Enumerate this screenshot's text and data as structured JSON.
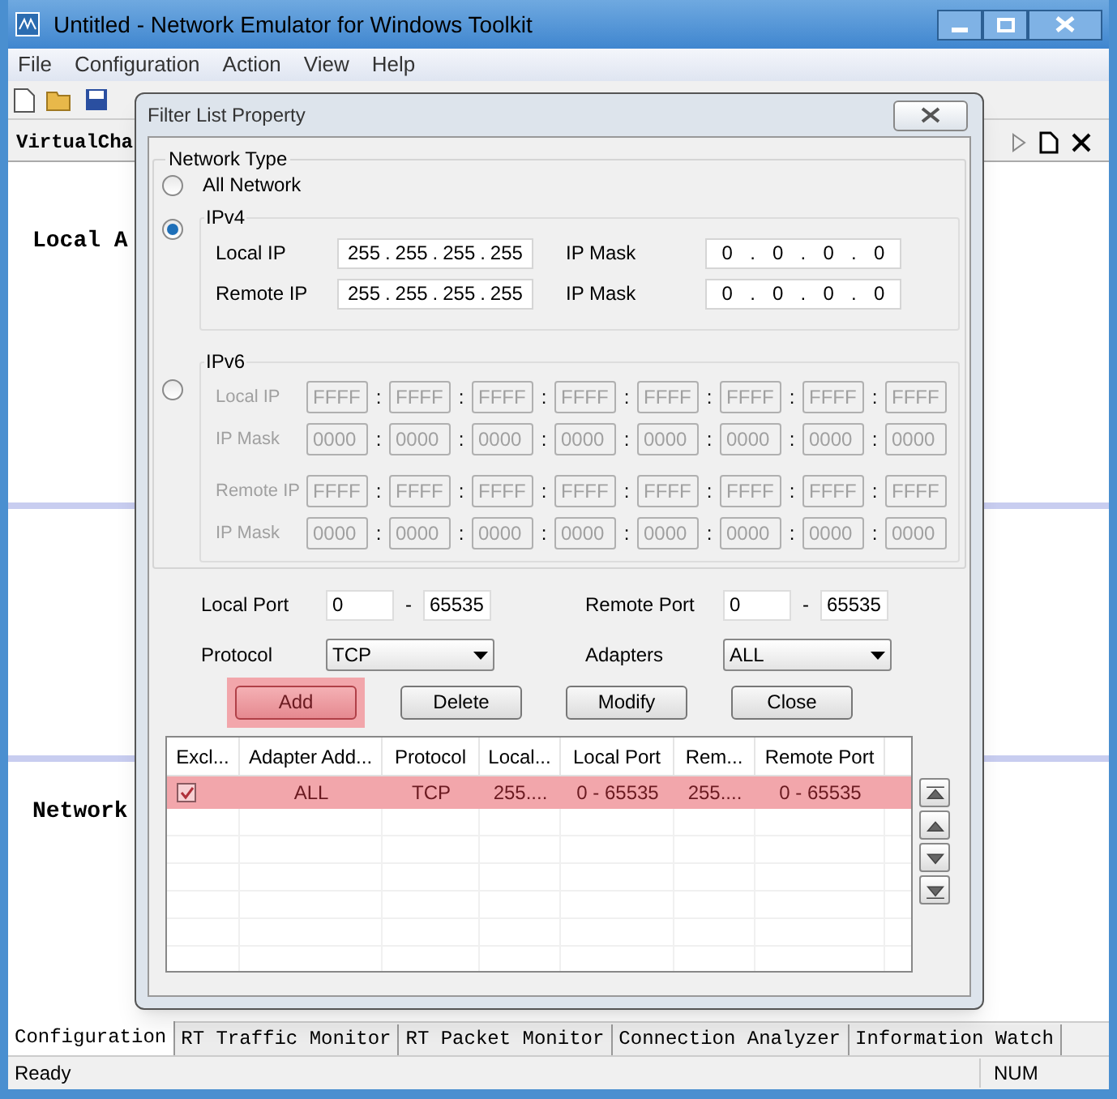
{
  "window": {
    "title": "Untitled - Network Emulator for Windows Toolkit"
  },
  "menu": [
    "File",
    "Configuration",
    "Action",
    "View",
    "Help"
  ],
  "document_tab": {
    "label": "VirtualCha"
  },
  "canvas_labels": [
    "Local A",
    "Network"
  ],
  "dialog": {
    "title": "Filter List Property",
    "network_type": {
      "label": "Network Type",
      "options": [
        {
          "label": "All Network",
          "selected": false
        },
        {
          "label": "IPv4",
          "selected": true
        }
      ]
    },
    "ipv4": {
      "separator": ".",
      "rows": [
        {
          "label": "Local IP",
          "octets": [
            "255",
            "255",
            "255",
            "255"
          ],
          "mask_label": "IP Mask",
          "mask": [
            "0",
            "0",
            "0",
            "0"
          ]
        },
        {
          "label": "Remote IP",
          "octets": [
            "255",
            "255",
            "255",
            "255"
          ],
          "mask_label": "IP Mask",
          "mask": [
            "0",
            "0",
            "0",
            "0"
          ]
        }
      ]
    },
    "ipv6": {
      "label": "IPv6",
      "selected": false,
      "disabled": true,
      "separator": ":",
      "groups": [
        [
          {
            "label": "Local IP",
            "values": [
              "FFFF",
              "FFFF",
              "FFFF",
              "FFFF",
              "FFFF",
              "FFFF",
              "FFFF",
              "FFFF"
            ]
          },
          {
            "label": "IP Mask",
            "values": [
              "0000",
              "0000",
              "0000",
              "0000",
              "0000",
              "0000",
              "0000",
              "0000"
            ]
          }
        ],
        [
          {
            "label": "Remote IP",
            "values": [
              "FFFF",
              "FFFF",
              "FFFF",
              "FFFF",
              "FFFF",
              "FFFF",
              "FFFF",
              "FFFF"
            ]
          },
          {
            "label": "IP Mask",
            "values": [
              "0000",
              "0000",
              "0000",
              "0000",
              "0000",
              "0000",
              "0000",
              "0000"
            ]
          }
        ]
      ]
    },
    "ports": {
      "dash": "-",
      "local": {
        "label": "Local Port",
        "from": "0",
        "to": "65535"
      },
      "remote": {
        "label": "Remote Port",
        "from": "0",
        "to": "65535"
      }
    },
    "protocol": {
      "label": "Protocol",
      "value": "TCP"
    },
    "adapters": {
      "label": "Adapters",
      "value": "ALL"
    },
    "buttons": [
      {
        "label": "Add",
        "highlighted": true
      },
      {
        "label": "Delete",
        "highlighted": false
      },
      {
        "label": "Modify",
        "highlighted": false
      },
      {
        "label": "Close",
        "highlighted": false
      }
    ],
    "table": {
      "columns": [
        "Excl...",
        "Adapter Add...",
        "Protocol",
        "Local...",
        "Local Port",
        "Rem...",
        "Remote Port"
      ],
      "rows": [
        {
          "selected": true,
          "cells": [
            {
              "kind": "checkbox",
              "checked": true
            },
            {
              "kind": "text",
              "text": "ALL"
            },
            {
              "kind": "text",
              "text": "TCP"
            },
            {
              "kind": "text",
              "text": "255...."
            },
            {
              "kind": "text",
              "text": "0 - 65535"
            },
            {
              "kind": "text",
              "text": "255...."
            },
            {
              "kind": "text",
              "text": "0 - 65535"
            }
          ]
        }
      ]
    }
  },
  "bottom_tabs": [
    {
      "label": "Configuration",
      "selected": true
    },
    {
      "label": "RT Traffic Monitor",
      "selected": false
    },
    {
      "label": "RT Packet Monitor",
      "selected": false
    },
    {
      "label": "Connection Analyzer",
      "selected": false
    },
    {
      "label": "Information Watch",
      "selected": false
    }
  ],
  "status_bar": {
    "message": "Ready",
    "indicator": "NUM"
  }
}
